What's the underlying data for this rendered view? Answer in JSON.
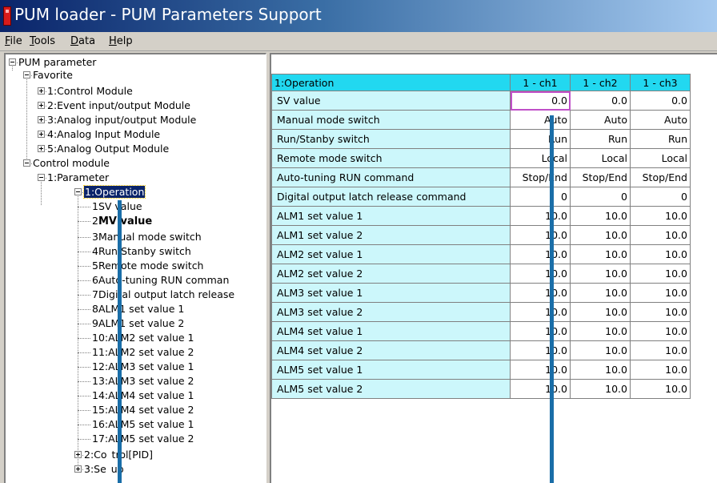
{
  "window": {
    "title": "PUM loader - PUM Parameters Support"
  },
  "menu": [
    {
      "label": "File",
      "accel": "F",
      "rest": "ile"
    },
    {
      "label": "Tools",
      "accel": "T",
      "rest": "ools"
    },
    {
      "label": "Data",
      "accel": "D",
      "rest": "ata"
    },
    {
      "label": "Help",
      "accel": "H",
      "rest": "elp"
    }
  ],
  "tree": {
    "nodes": [
      {
        "label": "PUM parameter",
        "toggle": "minus"
      },
      {
        "label": "Favorite",
        "toggle": "minus"
      },
      {
        "label": "1:Control Module",
        "toggle": "plus"
      },
      {
        "label": "2:Event input/output Module",
        "toggle": "plus"
      },
      {
        "label": "3:Analog input/output Module",
        "toggle": "plus"
      },
      {
        "label": "4:Analog Input Module",
        "toggle": "plus"
      },
      {
        "label": "5:Analog Output Module",
        "toggle": "plus"
      },
      {
        "label": "Control module",
        "toggle": "minus"
      },
      {
        "label": "1:Parameter",
        "toggle": "minus"
      },
      {
        "label": "1:Operation",
        "toggle": "minus",
        "selected": true
      },
      {
        "label": "SV value",
        "prefix": "1"
      },
      {
        "label": "MV value",
        "prefix": "2",
        "bold": true
      },
      {
        "label": "Manual mode switch",
        "prefix": "3"
      },
      {
        "label": "Run/Stanby switch",
        "prefix": "4"
      },
      {
        "label": "Remote mode switch",
        "prefix": "5"
      },
      {
        "label": "Auto-tuning RUN comman",
        "prefix": "6"
      },
      {
        "label": "Digital output latch release",
        "prefix": "7"
      },
      {
        "label": "ALM1 set value 1",
        "prefix": "8"
      },
      {
        "label": "ALM1 set value 2",
        "prefix": "9"
      },
      {
        "label": "0:ALM2 set value 1",
        "prefix": "1"
      },
      {
        "label": "1:ALM2 set value 2",
        "prefix": "1"
      },
      {
        "label": "2:ALM3 set value 1",
        "prefix": "1"
      },
      {
        "label": "3:ALM3 set value 2",
        "prefix": "1"
      },
      {
        "label": "4:ALM4 set value 1",
        "prefix": "1"
      },
      {
        "label": "5:ALM4 set value 2",
        "prefix": "1"
      },
      {
        "label": "6:ALM5 set value 1",
        "prefix": "1"
      },
      {
        "label": "7:ALM5 set value 2",
        "prefix": "1"
      },
      {
        "label": "2:Co",
        "label2": "trol[PID]",
        "toggle": "plus"
      },
      {
        "label": "3:Se",
        "label2": "up",
        "toggle": "plus"
      }
    ]
  },
  "grid": {
    "header": [
      "1:Operation",
      "1 - ch1",
      "1 - ch2",
      "1 - ch3"
    ],
    "rows": [
      {
        "name": "SV value",
        "ch1": "0.0",
        "ch2": "0.0",
        "ch3": "0.0"
      },
      {
        "name": "Manual mode switch",
        "ch1": "Auto",
        "ch2": "Auto",
        "ch3": "Auto"
      },
      {
        "name": "Run/Stanby switch",
        "ch1": "Run",
        "ch2": "Run",
        "ch3": "Run"
      },
      {
        "name": "Remote mode switch",
        "ch1": "Local",
        "ch2": "Local",
        "ch3": "Local"
      },
      {
        "name": "Auto-tuning RUN command",
        "ch1": "Stop/End",
        "ch2": "Stop/End",
        "ch3": "Stop/End"
      },
      {
        "name": "Digital output latch release command",
        "ch1": "0",
        "ch2": "0",
        "ch3": "0"
      },
      {
        "name": "ALM1 set value 1",
        "ch1": "10.0",
        "ch2": "10.0",
        "ch3": "10.0"
      },
      {
        "name": "ALM1 set value 2",
        "ch1": "10.0",
        "ch2": "10.0",
        "ch3": "10.0"
      },
      {
        "name": "ALM2 set value 1",
        "ch1": "10.0",
        "ch2": "10.0",
        "ch3": "10.0"
      },
      {
        "name": "ALM2 set value 2",
        "ch1": "10.0",
        "ch2": "10.0",
        "ch3": "10.0"
      },
      {
        "name": "ALM3 set value 1",
        "ch1": "10.0",
        "ch2": "10.0",
        "ch3": "10.0"
      },
      {
        "name": "ALM3 set value 2",
        "ch1": "10.0",
        "ch2": "10.0",
        "ch3": "10.0"
      },
      {
        "name": "ALM4 set value 1",
        "ch1": "10.0",
        "ch2": "10.0",
        "ch3": "10.0"
      },
      {
        "name": "ALM4 set value 2",
        "ch1": "10.0",
        "ch2": "10.0",
        "ch3": "10.0"
      },
      {
        "name": "ALM5 set value 1",
        "ch1": "10.0",
        "ch2": "10.0",
        "ch3": "10.0"
      },
      {
        "name": "ALM5 set value 2",
        "ch1": "10.0",
        "ch2": "10.0",
        "ch3": "10.0"
      }
    ]
  },
  "colors": {
    "grid_header": "#22d8f0",
    "row_header": "#ccf7fb",
    "marker_line": "#1a6ea8",
    "active_cell_border": "#c050c8"
  }
}
